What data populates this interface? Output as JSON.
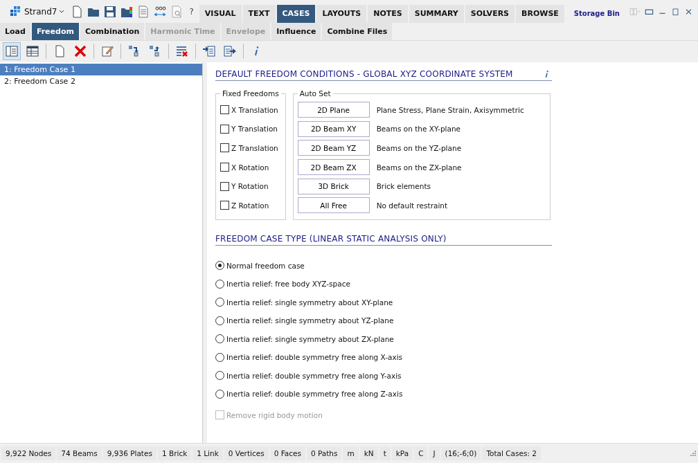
{
  "app": {
    "name": "Strand7",
    "help": "?"
  },
  "main_tabs": [
    {
      "label": "VISUAL",
      "selected": false
    },
    {
      "label": "TEXT",
      "selected": false
    },
    {
      "label": "CASES",
      "selected": true
    },
    {
      "label": "LAYOUTS",
      "selected": false
    },
    {
      "label": "NOTES",
      "selected": false
    },
    {
      "label": "SUMMARY",
      "selected": false
    },
    {
      "label": "SOLVERS",
      "selected": false
    },
    {
      "label": "BROWSE",
      "selected": false
    }
  ],
  "storage_bin": "Storage Bin",
  "sub_tabs": [
    {
      "label": "Load",
      "selected": false,
      "disabled": false
    },
    {
      "label": "Freedom",
      "selected": true,
      "disabled": false
    },
    {
      "label": "Combination",
      "selected": false,
      "disabled": false
    },
    {
      "label": "Harmonic Time",
      "selected": false,
      "disabled": true
    },
    {
      "label": "Envelope",
      "selected": false,
      "disabled": true
    },
    {
      "label": "Influence",
      "selected": false,
      "disabled": false
    },
    {
      "label": "Combine Files",
      "selected": false,
      "disabled": false
    }
  ],
  "toolbar": [
    {
      "kind": "list-view",
      "selected": true
    },
    {
      "kind": "table-view",
      "selected": false
    },
    {
      "kind": "new",
      "selected": false
    },
    {
      "kind": "delete",
      "selected": false
    },
    {
      "kind": "edit",
      "selected": false
    },
    {
      "kind": "move-down",
      "selected": false
    },
    {
      "kind": "move-up",
      "selected": false
    },
    {
      "kind": "clear",
      "selected": false
    },
    {
      "kind": "import",
      "selected": false
    },
    {
      "kind": "export",
      "selected": false
    },
    {
      "kind": "info",
      "selected": false
    }
  ],
  "cases": [
    {
      "label": "1: Freedom Case 1",
      "selected": true
    },
    {
      "label": "2: Freedom Case 2",
      "selected": false
    }
  ],
  "default_freedom": {
    "title": "DEFAULT FREEDOM CONDITIONS - GLOBAL XYZ COORDINATE SYSTEM",
    "fixed_freedoms": {
      "title": "Fixed Freedoms",
      "items": [
        {
          "label": "X Translation",
          "checked": false
        },
        {
          "label": "Y Translation",
          "checked": false
        },
        {
          "label": "Z Translation",
          "checked": false
        },
        {
          "label": "X Rotation",
          "checked": false
        },
        {
          "label": "Y Rotation",
          "checked": false
        },
        {
          "label": "Z Rotation",
          "checked": false
        }
      ]
    },
    "auto_set": {
      "title": "Auto Set",
      "rows": [
        {
          "button": "2D Plane",
          "description": "Plane Stress, Plane Strain, Axisymmetric"
        },
        {
          "button": "2D Beam XY",
          "description": "Beams on the XY-plane"
        },
        {
          "button": "2D Beam YZ",
          "description": "Beams on the YZ-plane"
        },
        {
          "button": "2D Beam ZX",
          "description": "Beams on the ZX-plane"
        },
        {
          "button": "3D Brick",
          "description": "Brick elements"
        },
        {
          "button": "All Free",
          "description": "No default restraint"
        }
      ]
    }
  },
  "case_type": {
    "title": "FREEDOM CASE TYPE (LINEAR STATIC ANALYSIS ONLY)",
    "options": [
      {
        "label": "Normal freedom case",
        "selected": true
      },
      {
        "label": "Inertia relief: free body XYZ-space",
        "selected": false
      },
      {
        "label": "Inertia relief: single symmetry about XY-plane",
        "selected": false
      },
      {
        "label": "Inertia relief: single symmetry about YZ-plane",
        "selected": false
      },
      {
        "label": "Inertia relief: single symmetry about ZX-plane",
        "selected": false
      },
      {
        "label": "Inertia relief: double symmetry free along X-axis",
        "selected": false
      },
      {
        "label": "Inertia relief: double symmetry free along Y-axis",
        "selected": false
      },
      {
        "label": "Inertia relief: double symmetry free along Z-axis",
        "selected": false
      }
    ],
    "remove_rigid": {
      "label": "Remove rigid body motion",
      "checked": false,
      "disabled": true
    }
  },
  "status_bar": [
    "9,922 Nodes",
    "74 Beams",
    "9,936 Plates",
    "1 Brick",
    "1 Link",
    "0 Vertices",
    "0 Faces",
    "0 Paths",
    "m",
    "kN",
    "t",
    "kPa",
    "C",
    "J",
    "(16;-6;0)",
    "Total Cases: 2"
  ]
}
